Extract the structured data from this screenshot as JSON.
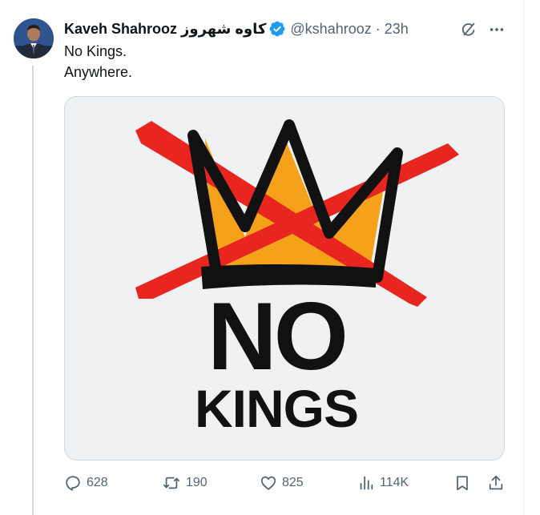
{
  "tweet": {
    "display_name": "Kaveh Shahrooz",
    "display_name_farsi": "کاوه شهروز",
    "verified": true,
    "handle": "@kshahrooz",
    "separator": "·",
    "time": "23h",
    "text_line1": "No Kings.",
    "text_line2": "Anywhere.",
    "media": {
      "line1": "NO",
      "line2": "KINGS",
      "colors": {
        "background": "#eff1f3",
        "cross": "#e8251f",
        "fill": "#f5a21a",
        "ink": "#111111"
      }
    },
    "actions": {
      "replies": "628",
      "reposts": "190",
      "likes": "825",
      "views": "114K"
    }
  },
  "icons": {
    "grok": "grok-icon",
    "more": "more-icon",
    "reply": "reply-icon",
    "repost": "repost-icon",
    "like": "like-icon",
    "views": "views-icon",
    "bookmark": "bookmark-icon",
    "share": "share-icon"
  },
  "colors": {
    "text": "#0f1419",
    "secondary": "#536471",
    "verified": "#1d9bf0",
    "border": "#cfd9de"
  }
}
